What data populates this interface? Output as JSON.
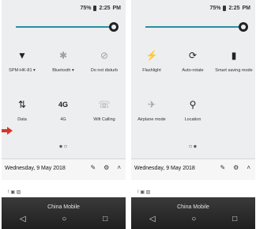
{
  "status": {
    "battery": "75%",
    "time": "2:25",
    "ampm": "PM"
  },
  "left": {
    "tiles": [
      {
        "label": "SPM-HK-81 ▾",
        "icon": "▼"
      },
      {
        "label": "Bluetooth ▾",
        "icon": "✱"
      },
      {
        "label": "Do not disturb",
        "icon": "⊘"
      },
      {
        "label": "Data",
        "icon": "⇅"
      },
      {
        "label": "4G",
        "icon": "4G"
      },
      {
        "label": "Wifi Calling",
        "icon": "☏"
      }
    ]
  },
  "right": {
    "tiles": [
      {
        "label": "Flashlight",
        "icon": "⚡"
      },
      {
        "label": "Auto-rotate",
        "icon": "⟳"
      },
      {
        "label": "Smart saving mode",
        "icon": "▮"
      },
      {
        "label": "Airplane mode",
        "icon": "✈"
      },
      {
        "label": "Location",
        "icon": "⚲"
      }
    ]
  },
  "bottom": {
    "date": "Wednesday, 9 May 2018",
    "carrier": "China Mobile"
  },
  "nav": {
    "back": "◁",
    "home": "○",
    "recents": "□"
  },
  "colors": {
    "accent": "#2a8fa0",
    "arrow": "#d9342b"
  }
}
